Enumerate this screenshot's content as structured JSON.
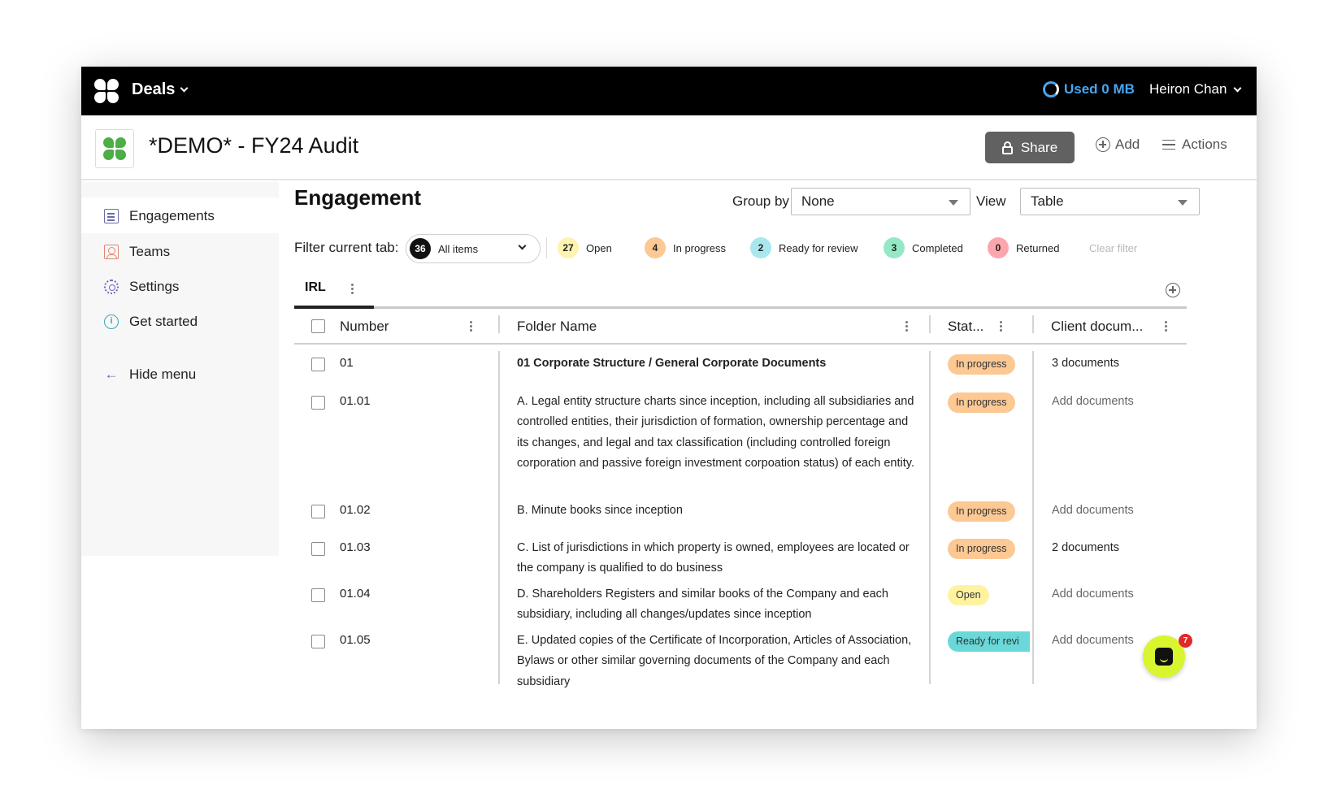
{
  "topbar": {
    "app_name": "Deals",
    "storage_label": "Used 0 MB",
    "user_name": "Heiron Chan"
  },
  "header": {
    "project_title": "*DEMO* - FY24 Audit",
    "share_label": "Share",
    "add_label": "Add",
    "actions_label": "Actions"
  },
  "sidebar": {
    "items": [
      {
        "label": "Engagements",
        "icon": "document-list-icon"
      },
      {
        "label": "Teams",
        "icon": "team-icon"
      },
      {
        "label": "Settings",
        "icon": "gear-icon"
      },
      {
        "label": "Get started",
        "icon": "info-icon"
      },
      {
        "label": "Hide menu",
        "icon": "arrow-left-icon"
      }
    ]
  },
  "main": {
    "title": "Engagement",
    "group_by_label": "Group by",
    "group_by_value": "None",
    "view_label": "View",
    "view_value": "Table",
    "filter_label": "Filter current tab:",
    "filter_select": {
      "count": "36",
      "label": "All items"
    },
    "status_filters": [
      {
        "count": "27",
        "label": "Open",
        "color": "#fff3b0"
      },
      {
        "count": "4",
        "label": "In progress",
        "color": "#fcc893"
      },
      {
        "count": "2",
        "label": "Ready for review",
        "color": "#a8e7ee"
      },
      {
        "count": "3",
        "label": "Completed",
        "color": "#95e8c6"
      },
      {
        "count": "0",
        "label": "Returned",
        "color": "#fba6ad"
      }
    ],
    "clear_filter_label": "Clear filter",
    "tabs": [
      {
        "label": "IRL"
      }
    ]
  },
  "table": {
    "columns": [
      "Number",
      "Folder Name",
      "Stat...",
      "Client docum..."
    ],
    "rows": [
      {
        "number": "01",
        "folder": "01 Corporate Structure / General Corporate Documents",
        "status": "In progress",
        "documents": "3 documents"
      },
      {
        "number": "01.01",
        "folder": "A. Legal entity structure charts since inception, including all subsidiaries and controlled entities, their jurisdiction of formation, ownership percentage and its changes, and legal and tax classification (including controlled foreign corporation and passive foreign investment corpoation status) of each entity.",
        "status": "In progress",
        "documents": "Add documents"
      },
      {
        "number": "01.02",
        "folder": "B. Minute books since inception",
        "status": "In progress",
        "documents": "Add documents"
      },
      {
        "number": "01.03",
        "folder": "C. List of jurisdictions in which property is owned, employees are located or the company is qualified to do business",
        "status": "In progress",
        "documents": "2 documents"
      },
      {
        "number": "01.04",
        "folder": "D. Shareholders Registers and similar books of the Company and each subsidiary, including all changes/updates since inception",
        "status": "Open",
        "documents": "Add documents"
      },
      {
        "number": "01.05",
        "folder": "E. Updated copies of the Certificate of Incorporation, Articles of Association, Bylaws or other similar governing documents of the Company and each subsidiary",
        "status": "Ready for revi",
        "documents": "Add documents"
      }
    ],
    "status_colors": {
      "In progress": "#fcc893",
      "Open": "#fff3a0",
      "Ready for revi": "#6ad8d8"
    }
  },
  "chat": {
    "unread_count": "7"
  }
}
